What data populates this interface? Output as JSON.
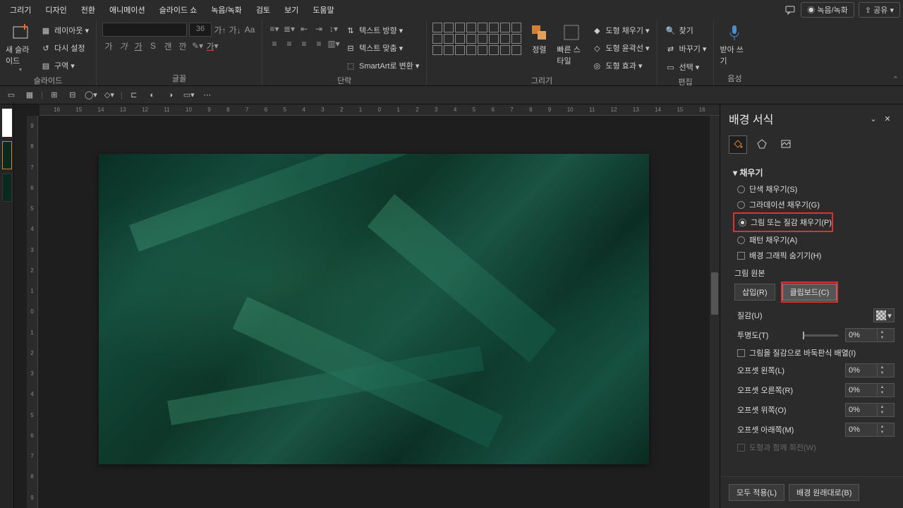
{
  "menubar": {
    "tabs": [
      "그리기",
      "디자인",
      "전환",
      "애니메이션",
      "슬라이드 쇼",
      "녹음/녹화",
      "검토",
      "보기",
      "도움말"
    ],
    "record": "녹음/녹화",
    "share": "공유"
  },
  "ribbon": {
    "slides": {
      "new_slide": "새 슬라이드",
      "layout": "레이아웃",
      "reset": "다시 설정",
      "section": "구역",
      "label": "슬라이드"
    },
    "font": {
      "size": "36",
      "label": "글꼴",
      "btns": {
        "bold": "가",
        "italic": "가",
        "underline": "가",
        "strike": "S",
        "spacing": "갠",
        "aa": "깐"
      }
    },
    "para": {
      "label": "단락",
      "textdir": "텍스트 방향",
      "align": "텍스트 맞춤",
      "smartart": "SmartArt로 변환"
    },
    "draw": {
      "label": "그리기",
      "arrange": "정렬",
      "quick": "빠른 스타일",
      "fill": "도형 채우기",
      "outline": "도형 윤곽선",
      "effects": "도형 효과"
    },
    "edit": {
      "label": "편집",
      "find": "찾기",
      "replace": "바꾸기",
      "select": "선택"
    },
    "voice": {
      "label": "음성",
      "dictate": "받아 쓰기"
    }
  },
  "hruler": [
    "16",
    "15",
    "14",
    "13",
    "12",
    "11",
    "10",
    "9",
    "8",
    "7",
    "6",
    "5",
    "4",
    "3",
    "2",
    "1",
    "0",
    "1",
    "2",
    "3",
    "4",
    "5",
    "6",
    "7",
    "8",
    "9",
    "10",
    "11",
    "12",
    "13",
    "14",
    "15",
    "16"
  ],
  "vruler": [
    "9",
    "8",
    "7",
    "6",
    "5",
    "4",
    "3",
    "2",
    "1",
    "0",
    "1",
    "2",
    "3",
    "4",
    "5",
    "6",
    "7",
    "8",
    "9"
  ],
  "pane": {
    "title": "배경 서식",
    "section": "채우기",
    "fills": {
      "solid": "단색 채우기(S)",
      "gradient": "그라데이션 채우기(G)",
      "picture": "그림 또는 질감 채우기(P)",
      "pattern": "패턴 채우기(A)",
      "hide": "배경 그래픽 숨기기(H)"
    },
    "source": {
      "label": "그림 원본",
      "insert": "삽입(R)",
      "clipboard": "클립보드(C)"
    },
    "texture": "질감(U)",
    "transparency": {
      "label": "투명도(T)",
      "value": "0%"
    },
    "tile": "그림을 질감으로 바둑판식 배열(I)",
    "offsets": {
      "left": {
        "label": "오프셋 왼쪽(L)",
        "value": "0%"
      },
      "right": {
        "label": "오프셋 오른쪽(R)",
        "value": "0%"
      },
      "top": {
        "label": "오프셋 위쪽(O)",
        "value": "0%"
      },
      "bottom": {
        "label": "오프셋 아래쪽(M)",
        "value": "0%"
      }
    },
    "rotate": "도형과 함께 회전(W)",
    "footer": {
      "apply_all": "모두 적용(L)",
      "reset": "배경 원래대로(B)"
    }
  }
}
